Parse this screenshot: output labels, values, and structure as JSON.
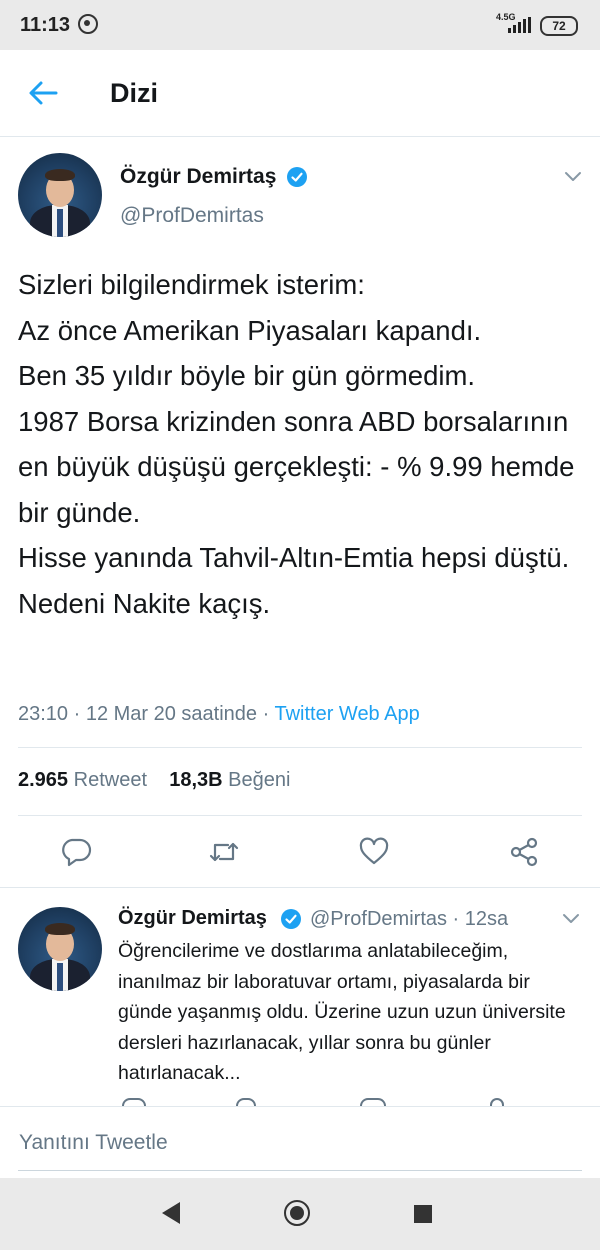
{
  "status_bar": {
    "time": "11:13",
    "network": "4.5G",
    "battery": "72"
  },
  "header": {
    "title": "Dizi"
  },
  "main_tweet": {
    "author_name": "Özgür Demirtaş",
    "handle": "@ProfDemirtas",
    "text": "Sizleri bilgilendirmek isterim:\nAz önce Amerikan Piyasaları kapandı.\nBen 35 yıldır böyle bir gün görmedim.\n1987 Borsa krizinden sonra ABD borsalarının en büyük düşüşü gerçekleşti: - % 9.99 hemde bir günde.\nHisse yanında Tahvil-Altın-Emtia hepsi düştü. Nedeni Nakite kaçış.",
    "timestamp": "23:10 · 12 Mar 20 saatinde · ",
    "source": "Twitter Web App",
    "retweet_count": "2.965",
    "retweet_label": "Retweet",
    "like_count": "18,3B",
    "like_label": "Beğeni"
  },
  "reply_tweet": {
    "author_name": "Özgür Demirtaş",
    "meta": "@ProfDemirtas · 12sa",
    "text": "Öğrencilerime ve dostlarıma anlatabileceğim, inanılmaz bir laboratuvar ortamı, piyasalarda bir günde yaşanmış oldu. Üzerine uzun uzun üniversite dersleri hazırlanacak, yıllar sonra bu günler hatırlanacak..."
  },
  "compose": {
    "placeholder": "Yanıtını Tweetle"
  },
  "colors": {
    "accent": "#1da1f2",
    "text": "#14171a",
    "muted": "#657786"
  }
}
